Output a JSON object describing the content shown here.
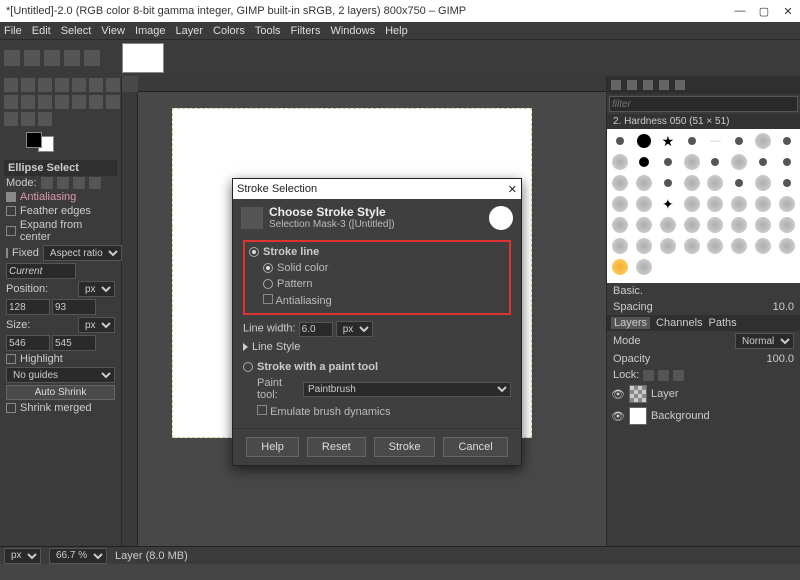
{
  "titlebar": {
    "title": "*[Untitled]-2.0 (RGB color 8-bit gamma integer, GIMP built-in sRGB, 2 layers) 800x750 – GIMP"
  },
  "menubar": [
    "File",
    "Edit",
    "Select",
    "View",
    "Image",
    "Layer",
    "Colors",
    "Tools",
    "Filters",
    "Windows",
    "Help"
  ],
  "left_panel": {
    "tool_header": "Ellipse Select",
    "mode_label": "Mode:",
    "antialiasing": "Antialiasing",
    "feather": "Feather edges",
    "expand": "Expand from center",
    "fixed": "Fixed",
    "aspect": "Aspect ratio",
    "current": "Current",
    "position": "Position:",
    "pos_unit": "px",
    "pos_x": "128",
    "pos_y": "93",
    "size": "Size:",
    "size_unit": "px",
    "size_w": "546",
    "size_h": "545",
    "highlight": "Highlight",
    "guides": "No guides",
    "auto_shrink": "Auto Shrink",
    "shrink_merged": "Shrink merged"
  },
  "right_panel": {
    "filter_placeholder": "filter",
    "brush_label": "2. Hardness 050 (51 × 51)",
    "basic": "Basic.",
    "spacing": "Spacing",
    "spacing_val": "10.0",
    "tabs": [
      "Layers",
      "Channels",
      "Paths"
    ],
    "mode": "Mode",
    "mode_val": "Normal",
    "opacity": "Opacity",
    "opacity_val": "100.0",
    "lock": "Lock:",
    "layer1": "Layer",
    "layer2": "Background"
  },
  "statusbar": {
    "unit": "px",
    "zoom": "66.7 %",
    "layer_info": "Layer (8.0 MB)"
  },
  "dialog": {
    "window_title": "Stroke Selection",
    "title": "Choose Stroke Style",
    "subtitle": "Selection Mask-3 ([Untitled])",
    "stroke_line": "Stroke line",
    "solid": "Solid color",
    "pattern": "Pattern",
    "antialias": "Antialiasing",
    "line_width": "Line width:",
    "line_width_val": "6.0",
    "line_width_unit": "px",
    "line_style": "Line Style",
    "stroke_paint": "Stroke with a paint tool",
    "paint_tool": "Paint tool:",
    "paint_sel": "Paintbrush",
    "emulate": "Emulate brush dynamics",
    "btn_help": "Help",
    "btn_reset": "Reset",
    "btn_stroke": "Stroke",
    "btn_cancel": "Cancel"
  }
}
